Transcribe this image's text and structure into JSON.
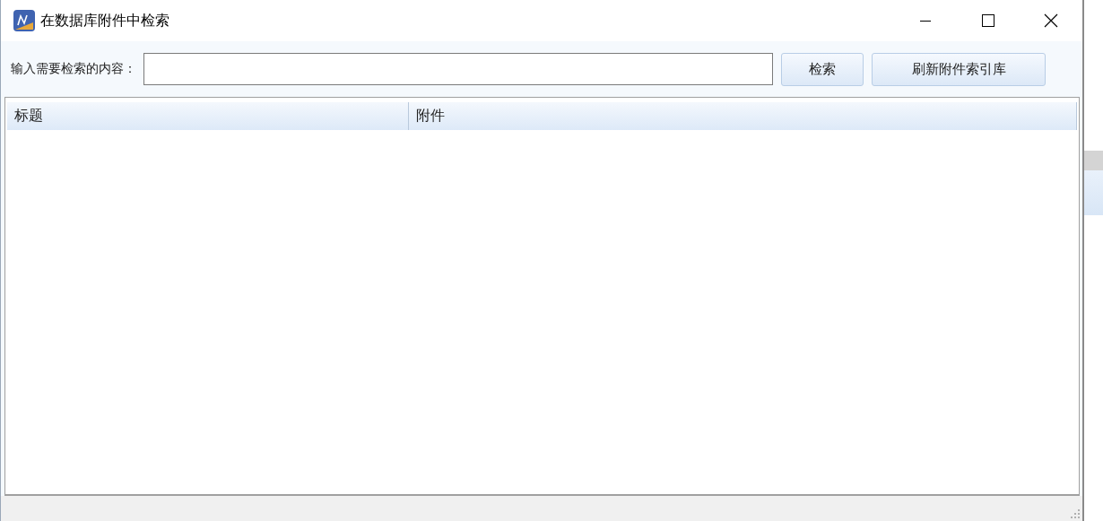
{
  "window": {
    "title": "在数据库附件中检索"
  },
  "search": {
    "label": "输入需要检索的内容："
  },
  "buttons": [
    "检索",
    "刷新附件索引库"
  ],
  "table": {
    "columns": [
      "标题",
      "附件"
    ]
  }
}
